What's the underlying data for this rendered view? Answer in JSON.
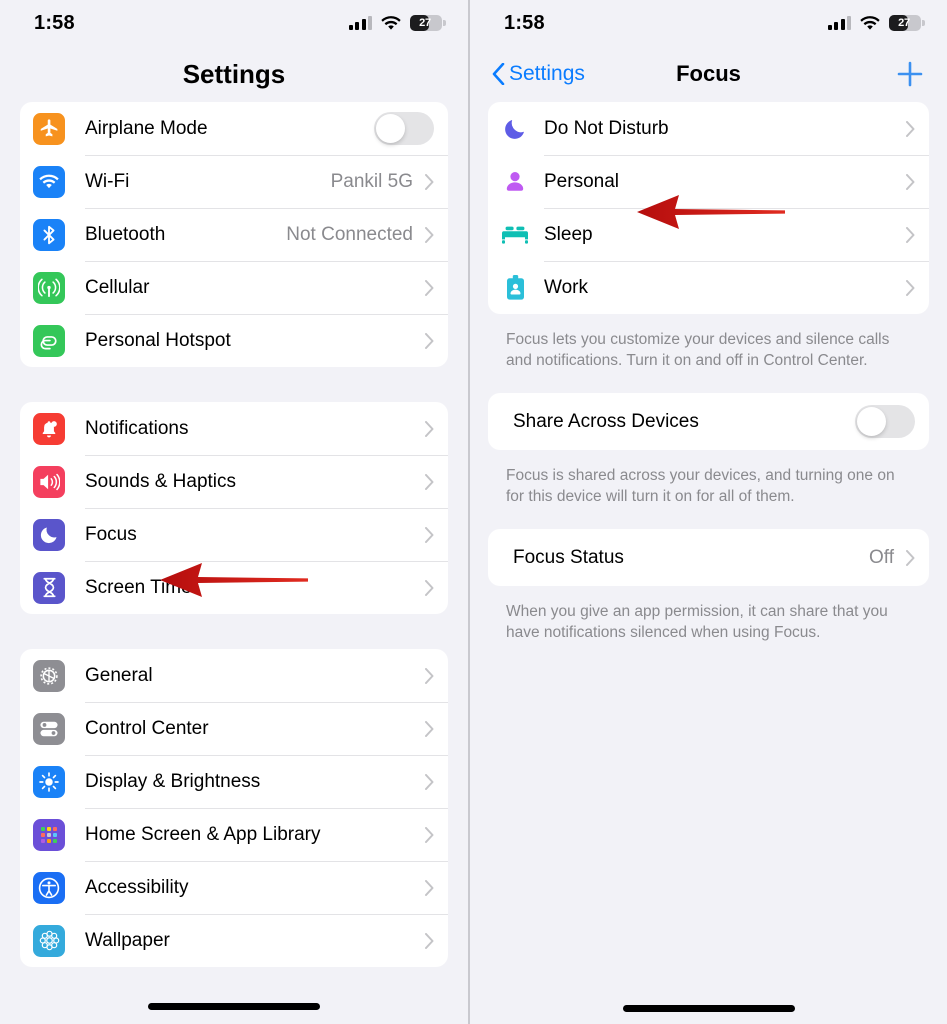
{
  "status_bar": {
    "time": "1:58",
    "battery_percent": "27",
    "signal_icon": "cellular-signal-icon",
    "wifi_icon": "wifi-icon",
    "battery_icon": "battery-icon"
  },
  "left_screen": {
    "title": "Settings",
    "groups": [
      {
        "rows": [
          {
            "label": "Airplane Mode",
            "icon": "airplane-icon",
            "icon_bg": "#f7921e",
            "control": "toggle",
            "toggle_on": false
          },
          {
            "label": "Wi-Fi",
            "icon": "wifi-icon",
            "icon_bg": "#1a82f7",
            "value": "Pankil 5G",
            "control": "chevron"
          },
          {
            "label": "Bluetooth",
            "icon": "bluetooth-icon",
            "icon_bg": "#1a82f7",
            "value": "Not Connected",
            "control": "chevron"
          },
          {
            "label": "Cellular",
            "icon": "cellular-antenna-icon",
            "icon_bg": "#34c759",
            "value": "",
            "control": "chevron"
          },
          {
            "label": "Personal Hotspot",
            "icon": "hotspot-link-icon",
            "icon_bg": "#34c759",
            "value": "",
            "control": "chevron"
          }
        ]
      },
      {
        "rows": [
          {
            "label": "Notifications",
            "icon": "notification-bell-icon",
            "icon_bg": "#f63c33",
            "value": "",
            "control": "chevron"
          },
          {
            "label": "Sounds & Haptics",
            "icon": "speaker-icon",
            "icon_bg": "#f43f5e",
            "value": "",
            "control": "chevron"
          },
          {
            "label": "Focus",
            "icon": "moon-icon",
            "icon_bg": "#5a55cb",
            "value": "",
            "control": "chevron",
            "highlighted": true
          },
          {
            "label": "Screen Time",
            "icon": "hourglass-icon",
            "icon_bg": "#5a55cb",
            "value": "",
            "control": "chevron"
          }
        ]
      },
      {
        "rows": [
          {
            "label": "General",
            "icon": "gear-icon",
            "icon_bg": "#8e8e93",
            "value": "",
            "control": "chevron"
          },
          {
            "label": "Control Center",
            "icon": "control-toggles-icon",
            "icon_bg": "#8e8e93",
            "value": "",
            "control": "chevron"
          },
          {
            "label": "Display & Brightness",
            "icon": "brightness-sun-icon",
            "icon_bg": "#1a82f7",
            "value": "",
            "control": "chevron"
          },
          {
            "label": "Home Screen & App Library",
            "icon": "app-grid-icon",
            "icon_bg": "#6b4fd8",
            "value": "",
            "control": "chevron"
          },
          {
            "label": "Accessibility",
            "icon": "accessibility-icon",
            "icon_bg": "#1a6ef4",
            "value": "",
            "control": "chevron"
          },
          {
            "label": "Wallpaper",
            "icon": "wallpaper-flower-icon",
            "icon_bg": "#34aadc",
            "value": "",
            "control": "chevron"
          }
        ]
      }
    ]
  },
  "right_screen": {
    "back_label": "Settings",
    "title": "Focus",
    "add_button": "plus-icon",
    "focus_modes": [
      {
        "label": "Do Not Disturb",
        "icon": "moon-icon",
        "icon_color": "#5e5ce6"
      },
      {
        "label": "Personal",
        "icon": "person-icon",
        "icon_color": "#bf5af2",
        "highlighted": true
      },
      {
        "label": "Sleep",
        "icon": "bed-icon",
        "icon_color": "#0fbfb4"
      },
      {
        "label": "Work",
        "icon": "id-card-icon",
        "icon_color": "#2bbfd9"
      }
    ],
    "focus_footnote": "Focus lets you customize your devices and silence calls and notifications. Turn it on and off in Control Center.",
    "share_row": {
      "label": "Share Across Devices",
      "toggle_on": false
    },
    "share_footnote": "Focus is shared across your devices, and turning one on for this device will turn it on for all of them.",
    "status_row": {
      "label": "Focus Status",
      "value": "Off"
    },
    "status_footnote": "When you give an app permission, it can share that you have notifications silenced when using Focus."
  },
  "annotations": {
    "arrow_color": "#cc1111",
    "arrow_focus_row": "arrow-pointing-at-focus",
    "arrow_personal_row": "arrow-pointing-at-personal"
  }
}
